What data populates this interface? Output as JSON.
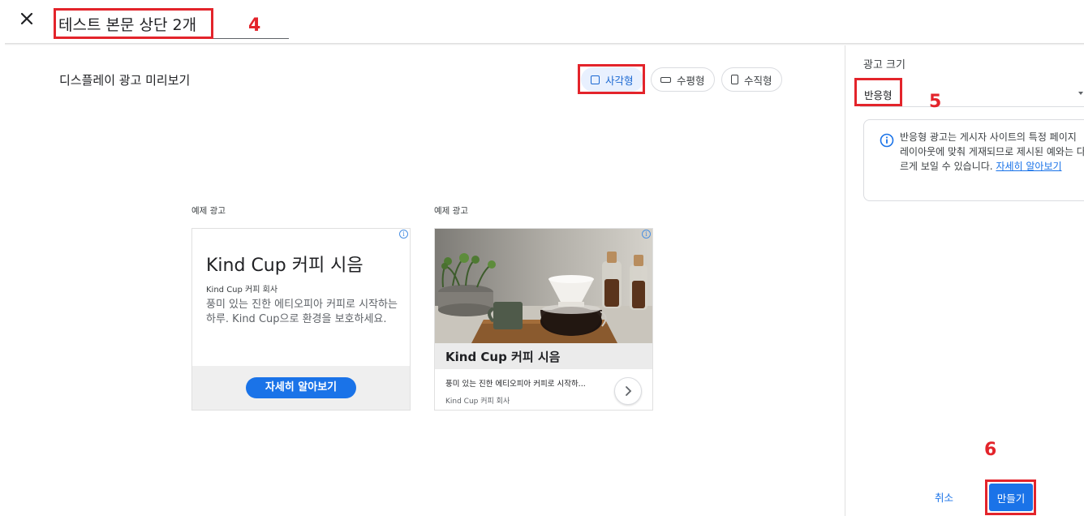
{
  "header": {
    "close_icon": "close-icon",
    "title_value": "테스트 본문 상단 2개"
  },
  "annotations": {
    "n4": "4",
    "n5": "5",
    "n6": "6"
  },
  "preview": {
    "title": "디스플레이 광고 미리보기",
    "shapes": [
      {
        "label": "사각형",
        "icon": "square-icon",
        "active": true
      },
      {
        "label": "수평형",
        "icon": "horizontal-rect-icon",
        "active": false
      },
      {
        "label": "수직형",
        "icon": "vertical-rect-icon",
        "active": false
      }
    ],
    "ads": [
      {
        "label": "예제 광고",
        "headline": "Kind Cup 커피 시음",
        "business": "Kind Cup 커피 회사",
        "description": "풍미 있는 진한 에티오피아 커피로 시작하는 하루. Kind Cup으로 환경을 보호하세요.",
        "cta": "자세히 알아보기",
        "adchoices": "i"
      },
      {
        "label": "예제 광고",
        "headline": "Kind Cup 커피 시음",
        "description": "풍미 있는 진한 에티오피아 커피로 시작하...",
        "business": "Kind Cup 커피 회사",
        "adchoices": "i"
      }
    ]
  },
  "side": {
    "size_label": "광고 크기",
    "size_value": "반응형",
    "info_text": "반응형 광고는 게시자 사이트의 특정 페이지 레이아웃에 맞춰 게재되므로 제시된 예와는 다르게 보일 수 있습니다. ",
    "info_link": "자세히 알아보기",
    "cancel": "취소",
    "create": "만들기"
  },
  "colors": {
    "accent": "#1a73e8",
    "annotation_red": "#e3242b",
    "active_chip_bg": "#e8f0fe"
  }
}
